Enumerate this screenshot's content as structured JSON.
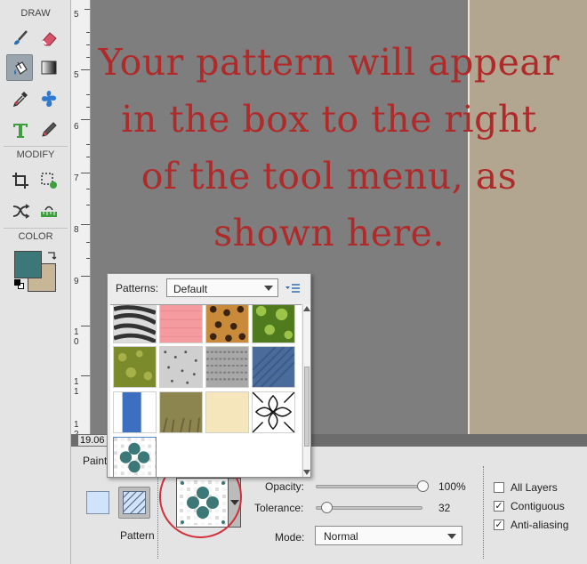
{
  "toolbar": {
    "draw_label": "DRAW",
    "modify_label": "MODIFY",
    "color_label": "COLOR",
    "foreground_color": "#3b7877",
    "background_color": "#c8b797"
  },
  "ruler": {
    "numbers": [
      "5",
      "6",
      "7",
      "8",
      "9",
      "1\n0",
      "1\n1",
      "1\n2"
    ]
  },
  "overlay_text": {
    "line1": "Your pattern will appear",
    "line2": "in the box to the right",
    "line3": "of the tool menu, as",
    "line4": "shown here."
  },
  "status": {
    "zoom": "19.06"
  },
  "patterns_popup": {
    "label": "Patterns:",
    "selected_set": "Default",
    "swatches": [
      "zebra",
      "pink-fabric",
      "leopard",
      "ivy",
      "moss",
      "granite",
      "grey-knit",
      "denim",
      "blue-fabric",
      "grass",
      "cream-paper",
      "tile-flower",
      "teal-quatrefoil"
    ]
  },
  "tool_options": {
    "paint_label": "Paint",
    "pattern_label": "Pattern",
    "opacity_label": "Opacity:",
    "opacity_value": "100%",
    "opacity_fraction": 1.0,
    "tolerance_label": "Tolerance:",
    "tolerance_value": "32",
    "tolerance_fraction": 0.1,
    "mode_label": "Mode:",
    "mode_value": "Normal",
    "all_layers_label": "All Layers",
    "all_layers_checked": false,
    "contiguous_label": "Contiguous",
    "contiguous_checked": true,
    "anti_aliasing_label": "Anti-aliasing",
    "anti_aliasing_checked": true,
    "highlight_color": "#d0313a"
  }
}
